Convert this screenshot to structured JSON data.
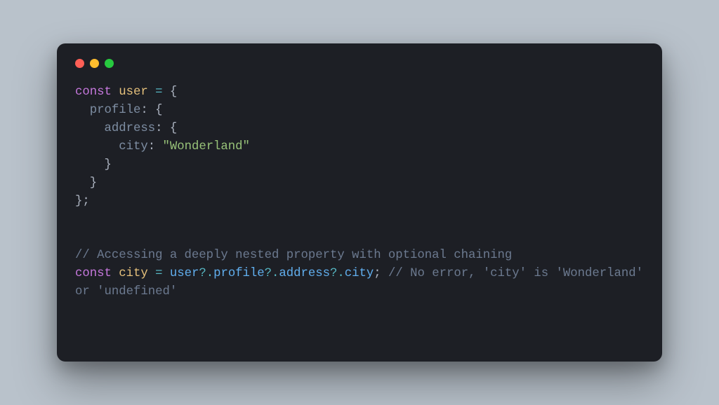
{
  "traffic_lights": {
    "red_title": "Close",
    "yellow_title": "Minimize",
    "green_title": "Zoom"
  },
  "code": {
    "l1": {
      "kw": "const",
      "sp1": " ",
      "var": "user",
      "sp2": " ",
      "eq": "=",
      "sp3": " ",
      "brace": "{"
    },
    "l2": {
      "indent": "  ",
      "key": "profile",
      "colon": ":",
      "sp": " ",
      "brace": "{"
    },
    "l3": {
      "indent": "    ",
      "key": "address",
      "colon": ":",
      "sp": " ",
      "brace": "{"
    },
    "l4": {
      "indent": "      ",
      "key": "city",
      "colon": ":",
      "sp": " ",
      "str": "\"Wonderland\""
    },
    "l5": {
      "indent": "    ",
      "brace": "}"
    },
    "l6": {
      "indent": "  ",
      "brace": "}"
    },
    "l7": {
      "brace": "}",
      "semi": ";"
    },
    "blank1": "",
    "blank2": "",
    "l8": {
      "cmt": "// Accessing a deeply nested property with optional chaining"
    },
    "l9": {
      "kw": "const",
      "sp1": " ",
      "var": "city",
      "sp2": " ",
      "eq": "=",
      "sp3": " ",
      "c0": "user",
      "q0": "?.",
      "c1": "profile",
      "q1": "?.",
      "c2": "address",
      "q2": "?.",
      "c3": "city",
      "semi": ";",
      "sp4": " ",
      "cmt": "// No error, 'city' is 'Wonderland' or 'undefined'"
    }
  }
}
